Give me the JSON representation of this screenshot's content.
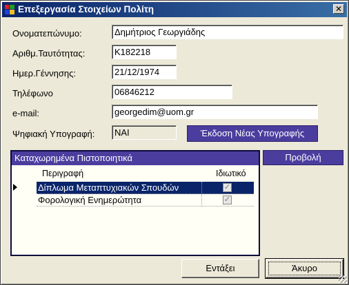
{
  "window": {
    "title": "Επεξεργασία Στοιχείων Πολίτη",
    "close_glyph": "✕"
  },
  "form": {
    "fullname": {
      "label": "Ονοματεπώνυμο:",
      "value": "Δημήτριος Γεωργιάδης"
    },
    "id_number": {
      "label": "Αριθμ.Ταυτότητας:",
      "value": "Κ182218"
    },
    "birthdate": {
      "label": "Ημερ.Γέννησης:",
      "value": "21/12/1974"
    },
    "phone": {
      "label": "Τηλέφωνο",
      "value": "06846212"
    },
    "email": {
      "label": "e-mail:",
      "value": "georgedim@uom.gr"
    },
    "signature": {
      "label": "Ψηφιακή Υπογραφή:",
      "value": "ΝΑΙ"
    }
  },
  "buttons": {
    "new_signature": "Έκδοση Νέας Υπογραφής",
    "view": "Προβολή",
    "ok": "Εντάξει",
    "cancel": "Άκυρο"
  },
  "certificates": {
    "title": "Καταχωρημένα Πιστοποιητικά",
    "columns": [
      "Περιγραφή",
      "Ιδιωτικό"
    ],
    "rows": [
      {
        "description": "Δίπλωμα Μεταπτυχιακών Σπουδών",
        "private": true,
        "selected": true
      },
      {
        "description": "Φορολογική Ενημερώτητα",
        "private": true,
        "selected": false
      }
    ]
  },
  "colors": {
    "accent": "#4b3d9e",
    "titlebar": "#0a246a",
    "window_bg": "#ece9d8",
    "selection": "#0a246a"
  }
}
